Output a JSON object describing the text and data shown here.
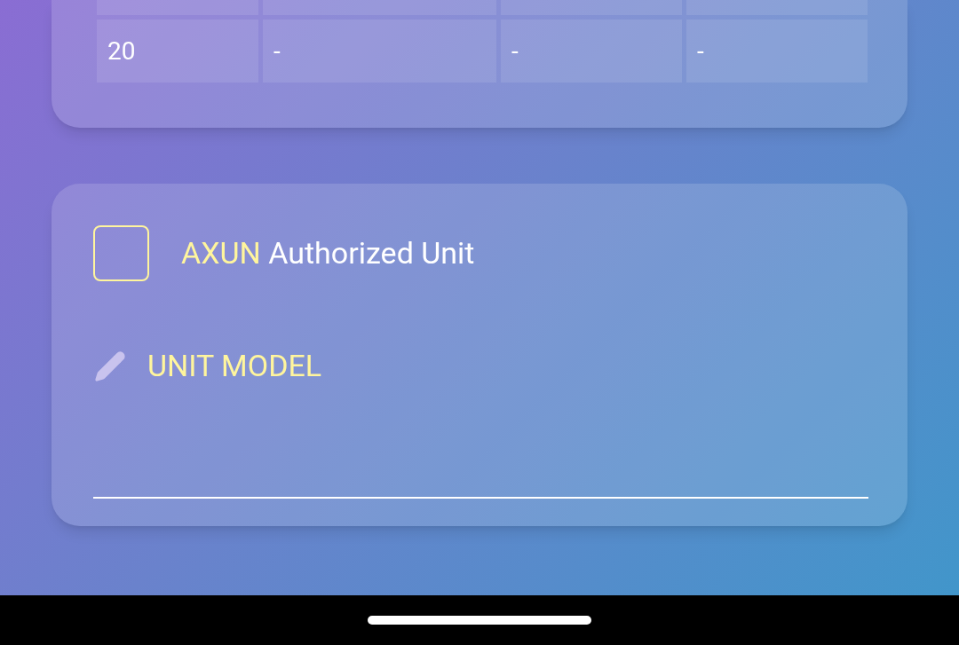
{
  "table": {
    "rows": [
      {
        "cells": [
          "20",
          "-",
          "-",
          "-"
        ]
      }
    ]
  },
  "authorization": {
    "brand": "AXUN",
    "label": "Authorized Unit",
    "checked": false
  },
  "unit_model": {
    "label": "UNIT MODEL"
  }
}
